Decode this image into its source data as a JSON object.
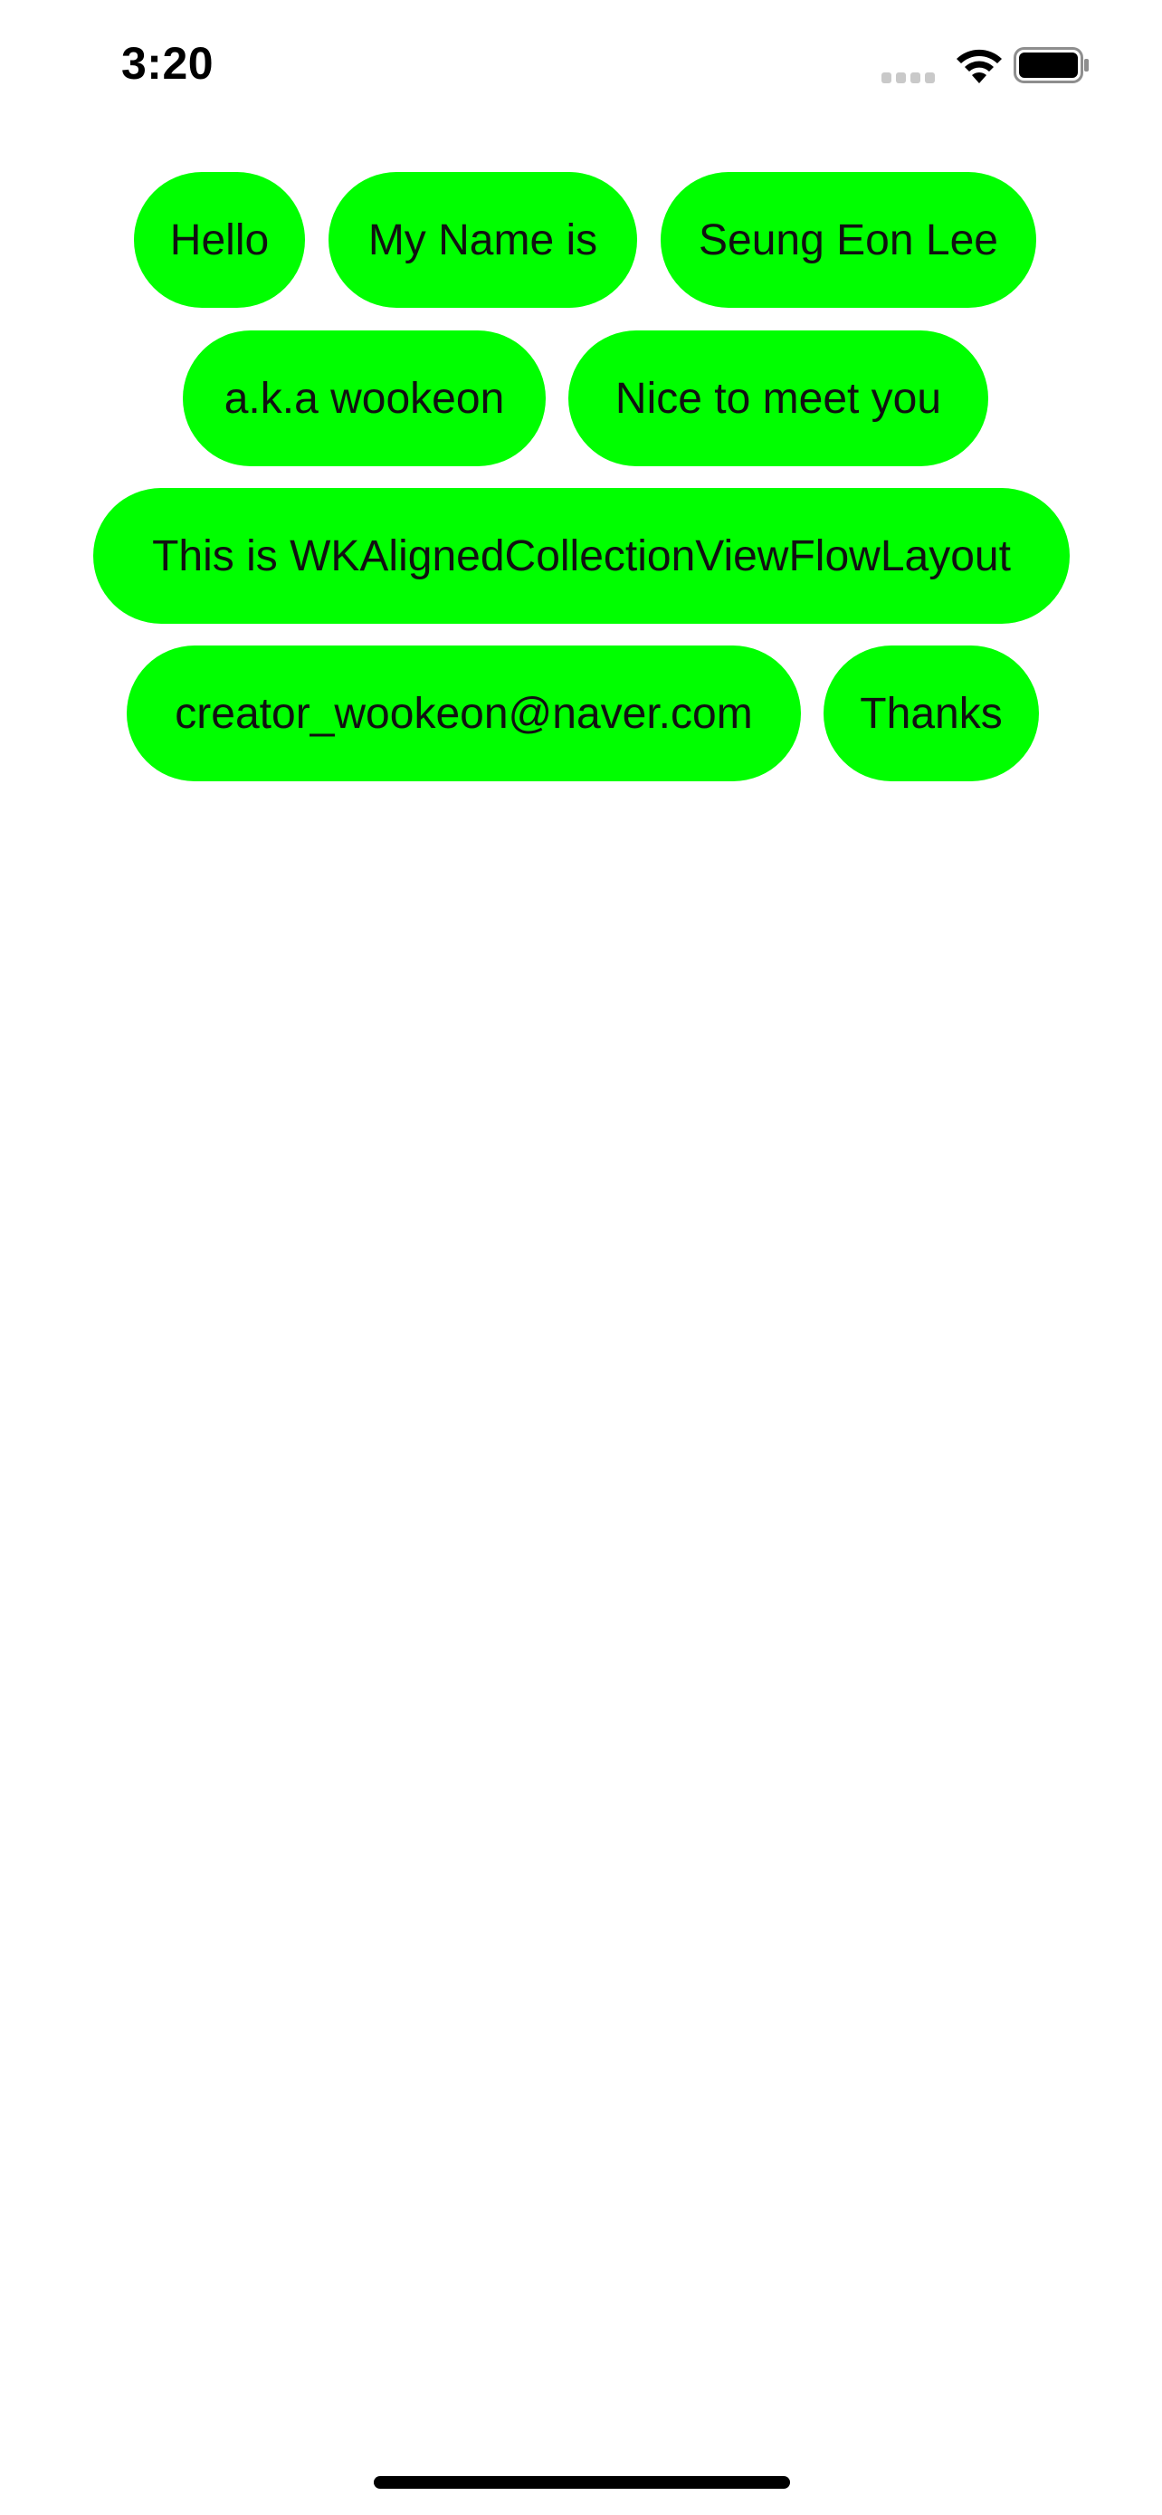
{
  "status_bar": {
    "time": "3:20",
    "icons": [
      "signal-icon",
      "wifi-icon",
      "battery-icon"
    ]
  },
  "tags": [
    "Hello",
    "My Name is",
    "Seung Eon Lee",
    "a.k.a wookeon",
    "Nice to meet you",
    "This is WKAlignedCollectionViewFlowLayout",
    "creator_wookeon@naver.com",
    "Thanks"
  ],
  "colors": {
    "tag_background": "#00ff00",
    "tag_text": "#111111",
    "background": "#ffffff"
  }
}
